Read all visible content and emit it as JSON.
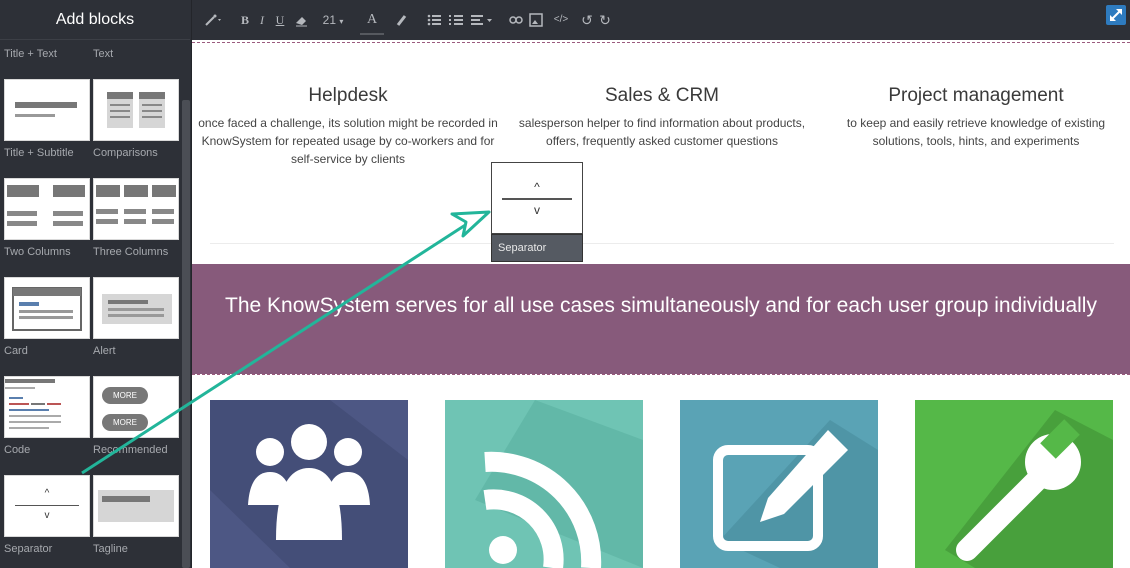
{
  "sidebar": {
    "title": "Add blocks",
    "blocks": [
      {
        "label": "Title + Text"
      },
      {
        "label": "Text"
      },
      {
        "label": "Title + Subtitle"
      },
      {
        "label": "Comparisons"
      },
      {
        "label": "Two Columns"
      },
      {
        "label": "Three Columns"
      },
      {
        "label": "Card"
      },
      {
        "label": "Alert"
      },
      {
        "label": "Code"
      },
      {
        "label": "Recommended",
        "buttons": [
          "MORE",
          "MORE"
        ]
      },
      {
        "label": "Separator",
        "glyphs": [
          "^",
          "v"
        ]
      },
      {
        "label": "Tagline"
      }
    ]
  },
  "toolbar": {
    "font_size": "21",
    "font_color_letter": "A",
    "bold": "B",
    "italic": "I",
    "underline": "U",
    "icons": [
      "magic-wand-icon",
      "bold-icon",
      "italic-icon",
      "underline-icon",
      "eraser-icon",
      "font-size-icon",
      "font-color-icon",
      "paint-brush-icon",
      "bullet-list-icon",
      "numbered-list-icon",
      "align-icon",
      "link-icon",
      "image-icon",
      "code-icon",
      "undo-icon",
      "redo-icon",
      "expand-icon"
    ]
  },
  "content": {
    "features": [
      {
        "title": "Helpdesk",
        "text": "once faced a challenge, its solution might be recorded in KnowSystem for repeated usage by co-workers and for self-service by clients"
      },
      {
        "title": "Sales & CRM",
        "text": "salesperson helper to find information about products, offers, frequently asked customer questions"
      },
      {
        "title": "Project management",
        "text": "to keep and easily retrieve knowledge of existing solutions, tools, hints, and experiments"
      }
    ],
    "banner": "The KnowSystem serves for all use cases simultaneously and for each user group individually",
    "icon_tiles": [
      {
        "icon": "users-group-icon",
        "color": "#4d5784"
      },
      {
        "icon": "rss-feed-icon",
        "color": "#6fc4b4"
      },
      {
        "icon": "edit-pencil-icon",
        "color": "#5aa3b5"
      },
      {
        "icon": "wrench-icon",
        "color": "#55b848"
      }
    ]
  },
  "drag_preview": {
    "label": "Separator",
    "up": "^",
    "down": "v"
  },
  "colors": {
    "banner": "#875a7b",
    "sidebar": "#2d3037",
    "arrow": "#22b59a",
    "accent_blue": "#2e7bbf"
  }
}
